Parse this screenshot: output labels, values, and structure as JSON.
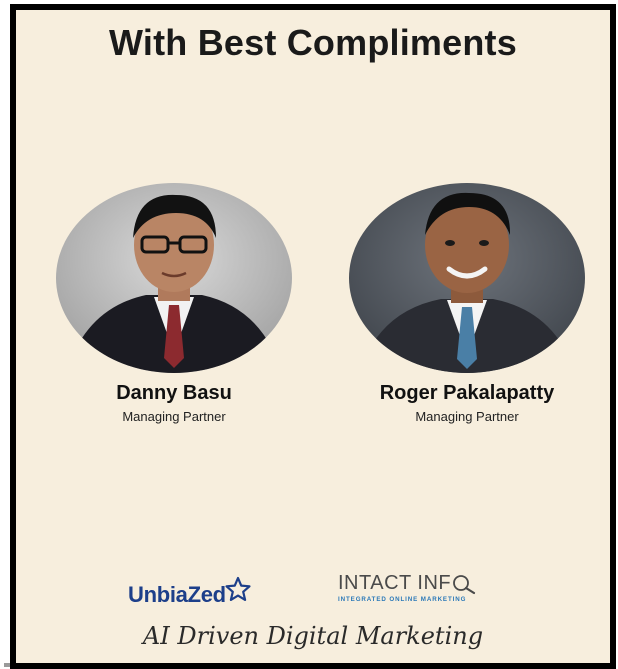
{
  "header": {
    "title": "With Best Compliments"
  },
  "people": [
    {
      "name": "Danny Basu",
      "role": "Managing Partner"
    },
    {
      "name": "Roger Pakalapatty",
      "role": "Managing Partner"
    }
  ],
  "logos": {
    "unbiazed": {
      "text": "UnbiaZed",
      "icon": "star-outline-icon"
    },
    "intact": {
      "main": "INTACT INF",
      "sub": "INTEGRATED ONLINE MARKETING",
      "icon": "magnifier-icon"
    }
  },
  "tagline": "AI Driven Digital Marketing",
  "colors": {
    "background": "#f7eedd",
    "border": "#000000",
    "unbiazed_blue": "#1d3f8a",
    "intact_blue": "#2a78b8"
  }
}
